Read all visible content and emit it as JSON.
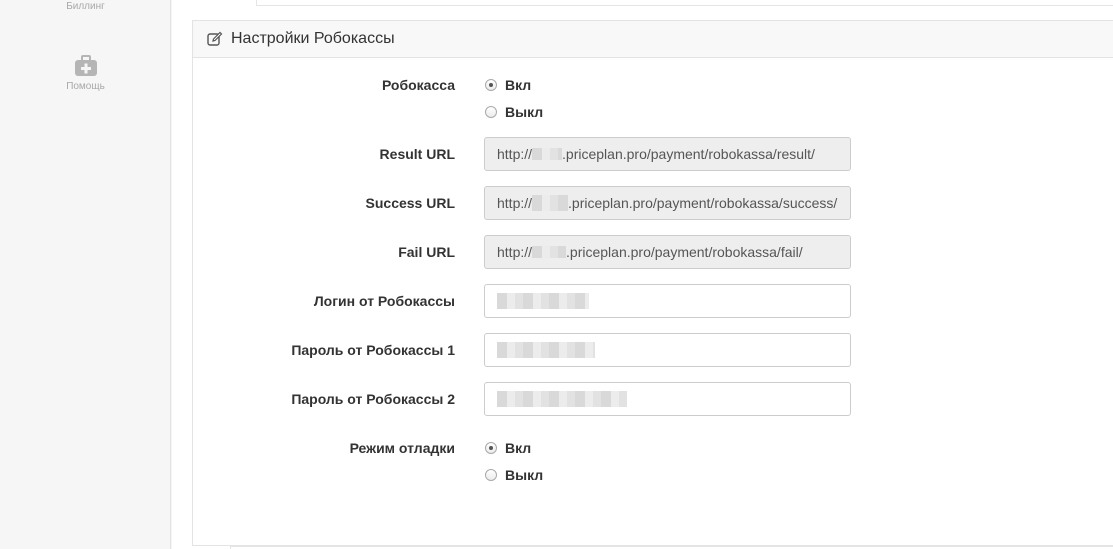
{
  "sidebar": {
    "billing_label": "Биллинг",
    "help_label": "Помощь",
    "help_icon": "medkit-icon"
  },
  "panel": {
    "title": "Настройки Робокассы",
    "icon": "edit-icon"
  },
  "form": {
    "robokassa": {
      "label": "Робокасса",
      "options": [
        "Вкл",
        "Выкл"
      ],
      "selected": "Вкл"
    },
    "result_url": {
      "label": "Result URL",
      "prefix": "http://",
      "suffix": ".priceplan.pro/payment/robokassa/result/"
    },
    "success_url": {
      "label": "Success URL",
      "prefix": "http://",
      "suffix": ".priceplan.pro/payment/robokassa/success/"
    },
    "fail_url": {
      "label": "Fail URL",
      "prefix": "http://",
      "suffix": ".priceplan.pro/payment/robokassa/fail/"
    },
    "login": {
      "label": "Логин от Робокассы"
    },
    "password1": {
      "label": "Пароль от Робокассы 1"
    },
    "password2": {
      "label": "Пароль от Робокассы 2"
    },
    "debug_mode": {
      "label": "Режим отладки",
      "options": [
        "Вкл",
        "Выкл"
      ],
      "selected": "Вкл"
    }
  },
  "colors": {
    "readonly_bg": "#eeeeee",
    "header_bg": "#f8f8f8",
    "sidebar_bg": "#f6f6f6"
  }
}
